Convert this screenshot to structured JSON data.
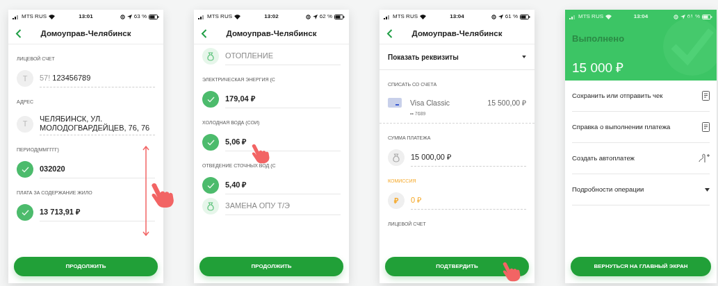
{
  "phones": [
    {
      "status": {
        "carrier": "MTS RUS",
        "time": "13:01",
        "battery": "63 %"
      },
      "header": {
        "kind": "nav",
        "title": "Домоуправ-Челябинск"
      },
      "hand": {
        "kind": "swipe"
      },
      "rows": [
        {
          "kind": "letter",
          "label": "ЛИЦЕВОЙ СЧЕТ",
          "badge": "T",
          "prefix": "57!",
          "value": "123456789"
        },
        {
          "kind": "letter",
          "label": "АДРЕС",
          "badge": "T",
          "value": "ЧЕЛЯБИНСК, УЛ. МОЛОДОГВАРДЕЙЦЕВ, 76, 76"
        },
        {
          "kind": "check",
          "label": "ПЕРИОД(ММГГГГ)",
          "value": "032020"
        },
        {
          "kind": "check",
          "label": "ПЛАТА ЗА СОДЕРЖАНИЕ ЖИЛО",
          "value": "13 713,91 ₽"
        }
      ],
      "button": "ПРОДОЛЖИТЬ"
    },
    {
      "status": {
        "carrier": "MTS RUS",
        "time": "13:02",
        "battery": "62 %"
      },
      "header": {
        "kind": "nav",
        "title": "Домоуправ-Челябинск"
      },
      "hand": {
        "kind": "tap-field"
      },
      "rows": [
        {
          "kind": "bag",
          "placeholder": "ОТОПЛЕНИЕ"
        },
        {
          "kind": "check",
          "label": "ЭЛЕКТРИЧЕСКАЯ ЭНЕРГИЯ (С",
          "value": "179,04 ₽"
        },
        {
          "kind": "check",
          "label": "ХОЛОДНАЯ ВОДА (СОИ)",
          "value": "5,06 ₽"
        },
        {
          "kind": "check",
          "label": "ОТВЕДЕНИЕ СТОЧНЫХ ВОД (С",
          "value": "5,40 ₽"
        },
        {
          "kind": "bag",
          "placeholder": "ЗАМЕНА ОПУ Т/Э"
        }
      ],
      "button": "ПРОДОЛЖИТЬ"
    },
    {
      "status": {
        "carrier": "MTS RUS",
        "time": "13:04",
        "battery": "61 %"
      },
      "header": {
        "kind": "nav",
        "title": "Домоуправ-Челябинск"
      },
      "hand": {
        "kind": "tap-button"
      },
      "rows": [
        {
          "kind": "dropdown",
          "label": "Показать реквизиты"
        },
        {
          "kind": "card",
          "label": "СПИСАТЬ СО СЧЕТА",
          "name": "Visa Classic",
          "amount": "15 500,00 ₽",
          "number": "•• 7689"
        },
        {
          "kind": "bag",
          "label": "СУММА ПЛАТЕЖА",
          "value": "15 000,00 ₽"
        },
        {
          "kind": "fee",
          "label": "КОМИССИЯ",
          "badge": "₽",
          "value": "0 ₽"
        },
        {
          "kind": "heading",
          "label": "ЛИЦЕВОЙ СЧЕТ"
        }
      ],
      "button": "ПОДТВЕРДИТЬ"
    },
    {
      "status": {
        "carrier": "MTS RUS",
        "time": "13:04",
        "battery": "61 %"
      },
      "header": {
        "kind": "success",
        "title": "Выполнено",
        "amount": "15 000 ₽"
      },
      "rows": [
        {
          "kind": "menu-document",
          "label": "Сохранить или отправить чек"
        },
        {
          "kind": "menu-document",
          "label": "Справка о выполнении платежа"
        },
        {
          "kind": "menu-autopay",
          "label": "Создать автоплатеж"
        },
        {
          "kind": "menu-expand",
          "label": "Подробности операции"
        }
      ],
      "button": "ВЕРНУТЬСЯ НА ГЛАВНЫЙ ЭКРАН"
    }
  ]
}
